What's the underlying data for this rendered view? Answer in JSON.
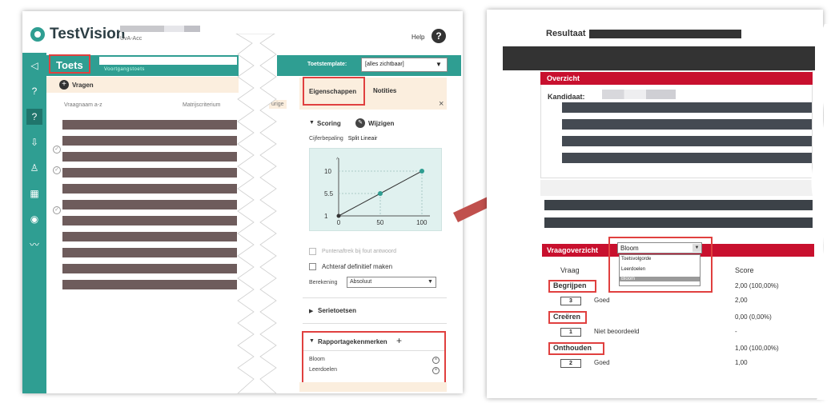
{
  "left_app": {
    "logo_text": "TestVision",
    "org_label": "UvA-Acc",
    "help_label": "Help",
    "help_icon": "?",
    "sidebar_icons": [
      "back-icon",
      "help-circle-icon",
      "question-square-icon",
      "export-icon",
      "user-icon",
      "calculator-icon",
      "eye-icon",
      "chart-icon"
    ],
    "sidebar_glyphs": [
      "◁",
      "?",
      "?",
      "⇩",
      "♙",
      "▦",
      "◉",
      "〰"
    ],
    "toets_title": "Toets",
    "toets_subtitle": "Voortgangstoets",
    "vragen_label": "Vragen",
    "col_vraagnaam": "Vraagnaam a-z",
    "col_matrix": "Matrijscriterium",
    "col_urige": "urige",
    "toetstemplate_label": "Toetstemplate:",
    "toetstemplate_value": "[alles zichtbaar]",
    "tab_eigenschappen": "Eigenschappen",
    "tab_notities": "Notities",
    "close_glyph": "×",
    "scoring_label": "Scoring",
    "wijzigen_label": "Wijzigen",
    "cijferbepaling_label": "Cijferbepaling",
    "cijferbepaling_value": "Split Lineair",
    "chart_axis_top": "^",
    "puntenaftrek_label": "Puntenaftrek bij fout antwoord",
    "achteraf_label": "Achteraf definitief maken",
    "berekening_label": "Berekening",
    "berekening_value": "Absoluut",
    "serietoetsen_label": "Serietoetsen",
    "rapportage_label": "Rapportagekenmerken",
    "rapportage_items": [
      "Bloom",
      "Leerdoelen"
    ]
  },
  "chart_data": {
    "type": "line",
    "x": [
      0,
      50,
      100
    ],
    "y": [
      1,
      5.5,
      10
    ],
    "xticks": [
      "0",
      "50",
      "100"
    ],
    "yticks": [
      "1",
      "5.5",
      "10"
    ],
    "xlim": [
      0,
      100
    ],
    "ylim": [
      1,
      10
    ],
    "grid": "dotted"
  },
  "right_report": {
    "resultaat_label": "Resultaat",
    "overzicht_title": "Overzicht",
    "kandidaat_label": "Kandidaat:",
    "vraagoverzicht_title": "Vraagoverzicht",
    "dropdown_selected": "Bloom",
    "dropdown_options": [
      "Toetsvolgorde",
      "Leerdoelen",
      "Bloom"
    ],
    "col_vraag": "Vraag",
    "col_score": "Score",
    "categories": [
      {
        "name": "Begrijpen",
        "score": "2,00 (100,00%)",
        "num": "3",
        "status": "Goed",
        "item_score": "2,00"
      },
      {
        "name": "Creëren",
        "score": "0,00 (0,00%)",
        "num": "1",
        "status": "Niet beoordeeld",
        "item_score": "-"
      },
      {
        "name": "Onthouden",
        "score": "1,00 (100,00%)",
        "num": "2",
        "status": "Goed",
        "item_score": "1,00"
      }
    ]
  },
  "colors": {
    "teal": "#2f9e92",
    "highlight_red": "#e0403f",
    "report_red": "#c8102e",
    "arrow_red": "#c0504d",
    "redaction_brown": "#6e5c5c"
  }
}
